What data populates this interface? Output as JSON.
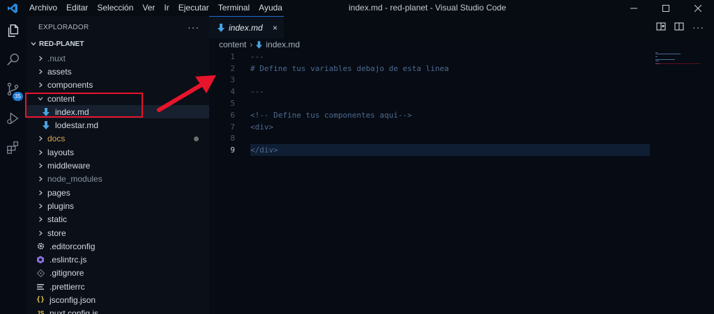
{
  "titlebar": {
    "menu": [
      "Archivo",
      "Editar",
      "Selección",
      "Ver",
      "Ir",
      "Ejecutar",
      "Terminal",
      "Ayuda"
    ],
    "window_title": "index.md - red-planet - Visual Studio Code"
  },
  "activity": {
    "source_control_badge": "35"
  },
  "sidebar": {
    "header": "EXPLORADOR",
    "more": "···",
    "root": "RED-PLANET",
    "items": [
      {
        "label": ".nuxt",
        "kind": "folder",
        "open": false,
        "color": "#8a949e"
      },
      {
        "label": "assets",
        "kind": "folder",
        "open": false,
        "color": "#d4dae0"
      },
      {
        "label": "components",
        "kind": "folder",
        "open": false,
        "color": "#d4dae0"
      },
      {
        "label": "content",
        "kind": "folder",
        "open": true,
        "color": "#d4dae0"
      },
      {
        "label": "index.md",
        "kind": "markdown",
        "color": "#d4dae0"
      },
      {
        "label": "lodestar.md",
        "kind": "markdown",
        "color": "#d4dae0"
      },
      {
        "label": "docs",
        "kind": "folder",
        "open": false,
        "color": "#d7a85a"
      },
      {
        "label": "layouts",
        "kind": "folder",
        "open": false,
        "color": "#d4dae0"
      },
      {
        "label": "middleware",
        "kind": "folder",
        "open": false,
        "color": "#d4dae0"
      },
      {
        "label": "node_modules",
        "kind": "folder",
        "open": false,
        "color": "#8a949e"
      },
      {
        "label": "pages",
        "kind": "folder",
        "open": false,
        "color": "#d4dae0"
      },
      {
        "label": "plugins",
        "kind": "folder",
        "open": false,
        "color": "#d4dae0"
      },
      {
        "label": "static",
        "kind": "folder",
        "open": false,
        "color": "#d4dae0"
      },
      {
        "label": "store",
        "kind": "folder",
        "open": false,
        "color": "#d4dae0"
      },
      {
        "label": ".editorconfig",
        "kind": "gear",
        "color": "#d4dae0"
      },
      {
        "label": ".eslintrc.js",
        "kind": "eslint",
        "color": "#d4dae0"
      },
      {
        "label": ".gitignore",
        "kind": "git",
        "color": "#d4dae0"
      },
      {
        "label": ".prettierrc",
        "kind": "lines",
        "color": "#d4dae0"
      },
      {
        "label": "jsconfig.json",
        "kind": "json",
        "color": "#d4dae0"
      },
      {
        "label": "nuxt.config.js",
        "kind": "js",
        "color": "#d4dae0"
      }
    ]
  },
  "editor": {
    "tab_label": "index.md",
    "tab_close": "×",
    "breadcrumb": [
      "content",
      "index.md"
    ],
    "lines": [
      {
        "n": "1",
        "text": "---"
      },
      {
        "n": "2",
        "text": "# Define tus variables debajo de esta linea"
      },
      {
        "n": "3",
        "text": ""
      },
      {
        "n": "4",
        "text": "---"
      },
      {
        "n": "5",
        "text": ""
      },
      {
        "n": "6",
        "text": "<!-- Define tus componentes aquí-->"
      },
      {
        "n": "7",
        "text": "<div>"
      },
      {
        "n": "8",
        "text": ""
      },
      {
        "n": "9",
        "text": "</div>"
      }
    ],
    "current_line": 9
  },
  "colors": {
    "accent": "#1f7ad6",
    "annotation": "#e8142b",
    "markdown_icon": "#4aa3df"
  }
}
